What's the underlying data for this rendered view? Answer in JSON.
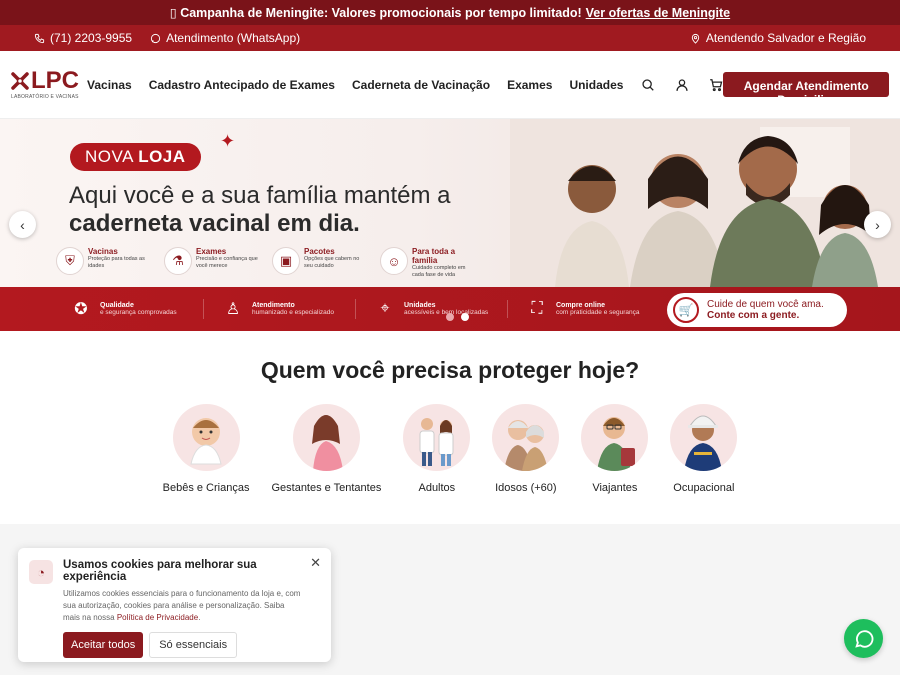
{
  "promo": {
    "icon": "megaphone-icon",
    "text": "▯ Campanha de Meningite: Valores promocionais por tempo limitado!",
    "link": "Ver ofertas de Meningite"
  },
  "contact": {
    "phone": "(71) 2203-9955",
    "whatsapp": "Atendimento (WhatsApp)",
    "region": "Atendendo Salvador e Região"
  },
  "brand": {
    "name": "LPC",
    "tagline": "LABORATÓRIO E VACINAS",
    "color": "#8b1a1f"
  },
  "nav": {
    "items": [
      "Vacinas",
      "Cadastro Antecipado de Exames",
      "Caderneta de Vacinação",
      "Exames",
      "Unidades"
    ],
    "icons": [
      "search-icon",
      "user-icon",
      "cart-icon"
    ],
    "cta": "Agendar Atendimento Domiciliar"
  },
  "hero": {
    "badge_prefix": "NOVA ",
    "badge_bold": "LOJA",
    "headline_line1": "Aqui você e a sua família mantém a",
    "headline_line2": "caderneta vacinal em dia.",
    "features": [
      {
        "title": "Vacinas",
        "desc": "Proteção para todas as idades",
        "icon": "shield-check-icon"
      },
      {
        "title": "Exames",
        "desc": "Precisão e confiança que você merece",
        "icon": "test-tube-icon"
      },
      {
        "title": "Pacotes",
        "desc": "Opções que cabem no seu cuidado",
        "icon": "box-icon"
      },
      {
        "title": "Para toda a família",
        "desc": "Cuidado completo em cada fase de vida",
        "icon": "family-icon"
      }
    ],
    "band": [
      {
        "title": "Qualidade",
        "desc": "e segurança comprovadas",
        "icon": "award-icon"
      },
      {
        "title": "Atendimento",
        "desc": "humanizado e especializado",
        "icon": "person-icon"
      },
      {
        "title": "Unidades",
        "desc": "acessíveis e bem localizadas",
        "icon": "location-icon"
      },
      {
        "title": "Compre online",
        "desc": "com praticidade e segurança",
        "icon": "bag-icon"
      }
    ],
    "pill_line1": "Cuide de quem você ama.",
    "pill_line2": "Conte com a gente.",
    "slide_count": 2,
    "active_slide": 2
  },
  "protect": {
    "title": "Quem você precisa proteger hoje?",
    "groups": [
      {
        "label": "Bebês e Crianças",
        "icon": "baby-icon"
      },
      {
        "label": "Gestantes e Tentantes",
        "icon": "pregnant-woman-icon"
      },
      {
        "label": "Adultos",
        "icon": "adults-icon"
      },
      {
        "label": "Idosos (+60)",
        "icon": "elderly-icon"
      },
      {
        "label": "Viajantes",
        "icon": "traveler-icon"
      },
      {
        "label": "Ocupacional",
        "icon": "worker-icon"
      }
    ]
  },
  "cookie": {
    "title": "Usamos cookies para melhorar sua experiência",
    "text": "Utilizamos cookies essenciais para o funcionamento da loja e, com sua autorização, cookies para análise e personalização. Saiba mais na nossa",
    "link": "Política de Privacidade",
    "link_suffix": ".",
    "accept": "Aceitar todos",
    "essential": "Só essenciais"
  }
}
